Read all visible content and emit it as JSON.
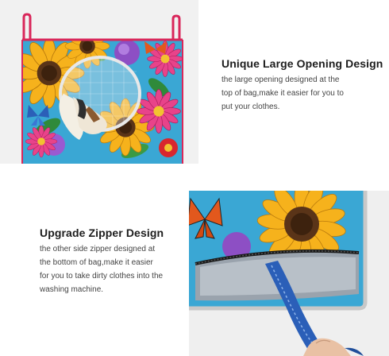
{
  "sections": [
    {
      "heading": "Unique Large Opening Design",
      "lines": [
        "the large opening designed at the",
        "top of bag,make it easier for you to",
        "put your clothes."
      ]
    },
    {
      "heading": "Upgrade Zipper Design",
      "lines": [
        "the other side zipper designed at",
        "the bottom of bag,make it easier",
        "for you to take dirty clothes into the",
        "washing machine."
      ]
    }
  ],
  "photos": {
    "top": "hanging laundry bag with sunflower and butterfly print, mesh opening with clothes",
    "bottom": "close-up of bottom zipper opening with hand pulling blue zipper tab"
  },
  "colors": {
    "heading": "#1d1d1d",
    "body": "#444444",
    "sky": "#39a9d8",
    "sunflower": "#f5b01d",
    "sunflower_center": "#5a3418",
    "trim": "#d9265a",
    "zipper": "#2b5fb8"
  }
}
